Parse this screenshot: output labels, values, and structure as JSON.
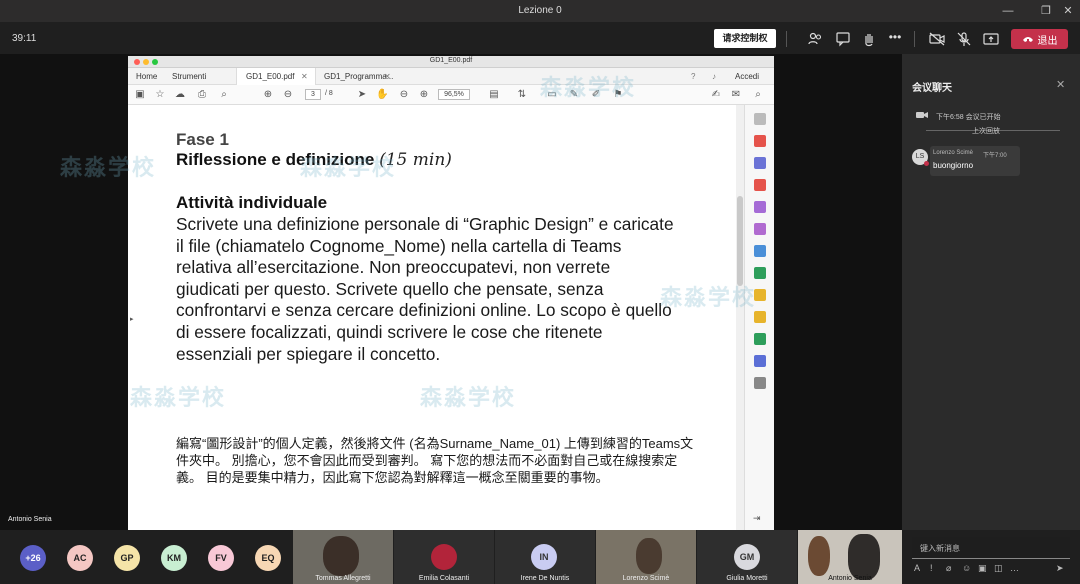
{
  "window": {
    "title": "Lezione 0"
  },
  "toolbar": {
    "timer": "39:11",
    "request_control": "请求控制权",
    "leave": "退出"
  },
  "pdf": {
    "file_title": "GD1_E00.pdf",
    "tabs": {
      "home": "Home",
      "tools": "Strumenti",
      "file1": "GD1_E00.pdf",
      "file2": "GD1_Programma...",
      "share": "Accedi"
    },
    "page_current": "3",
    "page_total": "/ 8",
    "zoom": "96,5%",
    "doc": {
      "heading": "Fase 1",
      "subheading": "Riflessione e definizione",
      "subheading_time": "(15 min)",
      "section": "Attività individuale",
      "body_it": "Scrivete una definizione personale di “Graphic Design” e caricate il file (chiamatelo Cognome_Nome) nella cartella di Teams relativa all’esercitazione. Non preoccupatevi, non verrete giudicati per questo. Scrivete quello che pensate, senza confrontarvi e senza cercare definizioni online. Lo scopo è quello di essere focalizzati, quindi scrivere le cose che ritenete essenziali per spiegare il concetto.",
      "body_zh": "編寫“圖形設計”的個人定義，然後將文件 (名為Surname_Name_01) 上傳到練習的Teams文件夾中。 別擔心，您不會因此而受到審判。 寫下您的想法而不必面對自己或在線搜索定義。 目的是要集中精力，因此寫下您認為對解釋這一概念至關重要的事物。"
    }
  },
  "chat": {
    "title": "会议聊天",
    "meeting_started": "下午6:58   会议已开始",
    "previous_convo": "上次回放",
    "message": {
      "avatar": "LS",
      "name": "Lorenzo Scimè",
      "time": "下午7:00",
      "text": "buongiorno"
    },
    "input_placeholder": "键入新消息"
  },
  "participants": {
    "overflow": "+26",
    "avatars": [
      {
        "initials": "AC",
        "color": "#f4c7c3"
      },
      {
        "initials": "GP",
        "color": "#f5e4a8"
      },
      {
        "initials": "KM",
        "color": "#c8eed2"
      },
      {
        "initials": "FV",
        "color": "#f8c8d6"
      },
      {
        "initials": "EQ",
        "color": "#f7d7b4"
      }
    ],
    "tiles": [
      {
        "name": "Tommas Allegretti",
        "kind": "video"
      },
      {
        "name": "Emilia Colasanti",
        "kind": "photo"
      },
      {
        "name": "Irene De Nuntis",
        "kind": "initials",
        "initials": "IN"
      },
      {
        "name": "Lorenzo Scimè",
        "kind": "video"
      },
      {
        "name": "Giulia Moretti",
        "kind": "initials",
        "initials": "GM"
      },
      {
        "name": "Antonio Senia",
        "kind": "video"
      }
    ],
    "speaker": "Antonio Senia"
  },
  "watermark": "森淼学校"
}
